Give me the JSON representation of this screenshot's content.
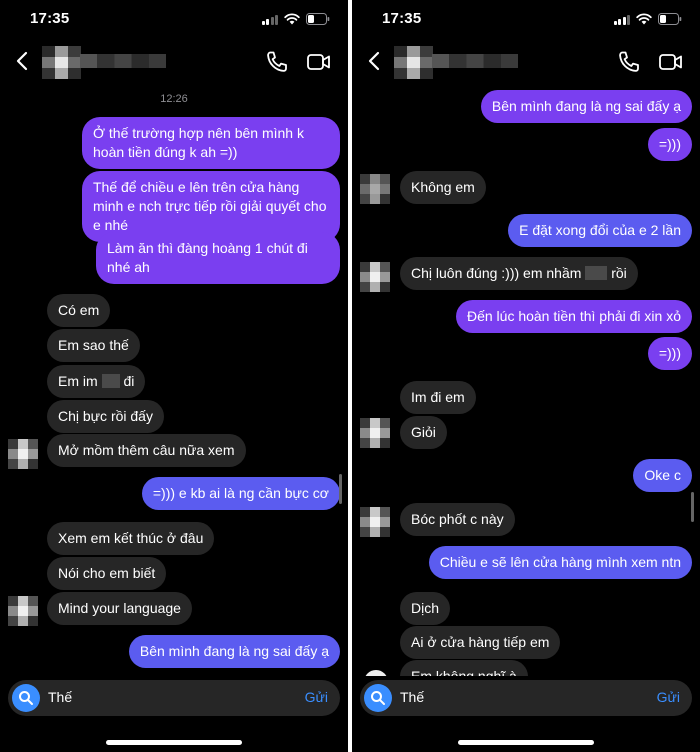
{
  "colors": {
    "outgoing": "#7a3ff0",
    "outgoing_blue": "#5b5cf0",
    "incoming": "#262626",
    "accent": "#3a8eff"
  },
  "left": {
    "status": {
      "time": "17:35"
    },
    "timestamp": "12:26",
    "messages": [
      {
        "text": "Ở thế trường hợp nên bên mình k hoàn tiền đúng k ah =))"
      },
      {
        "text": "Thế để chiều e lên trên cửa hàng minh e nch trực tiếp rồi giải quyết cho e nhé"
      },
      {
        "text": "Làm ăn thì đàng hoàng 1 chút đi nhé ah"
      },
      {
        "text": "Có em"
      },
      {
        "text": "Em sao thế"
      },
      {
        "text_a": "Em im ",
        "text_b": " đi"
      },
      {
        "text": "Chị bực rồi đấy"
      },
      {
        "text": "Mở mồm thêm câu nữa xem"
      },
      {
        "text": "=))) e kb ai là ng cần bực cơ"
      },
      {
        "text": "Xem em kết thúc ở đâu"
      },
      {
        "text": "Nói cho em biết"
      },
      {
        "text": "Mind your language"
      },
      {
        "text": "Bên mình đang là ng sai đấy ạ"
      }
    ],
    "composer": {
      "draft": "Thế",
      "send": "Gửi"
    }
  },
  "right": {
    "status": {
      "time": "17:35"
    },
    "messages": [
      {
        "text": "Bên mình đang là ng sai đấy ạ"
      },
      {
        "text": "=)))"
      },
      {
        "text": "Không em"
      },
      {
        "text": "E đặt xong đổi của e 2 lần"
      },
      {
        "text_a": "Chị luôn đúng :))) em nhầm ",
        "text_b": " rồi"
      },
      {
        "text": "Đến lúc hoàn tiền thì phải đi xin xỏ"
      },
      {
        "text": "=)))"
      },
      {
        "text": "Im đi em"
      },
      {
        "text": "Giỏi"
      },
      {
        "text": "Oke c"
      },
      {
        "text": "Bóc phốt c này"
      },
      {
        "text": "Chiều e sẽ lên cửa hàng mình xem ntn"
      },
      {
        "text": "Dịch"
      },
      {
        "text": "Ai ở cửa hàng tiếp em"
      },
      {
        "text": "Em không nghĩ à"
      }
    ],
    "composer": {
      "draft": "Thế",
      "send": "Gửi"
    }
  }
}
